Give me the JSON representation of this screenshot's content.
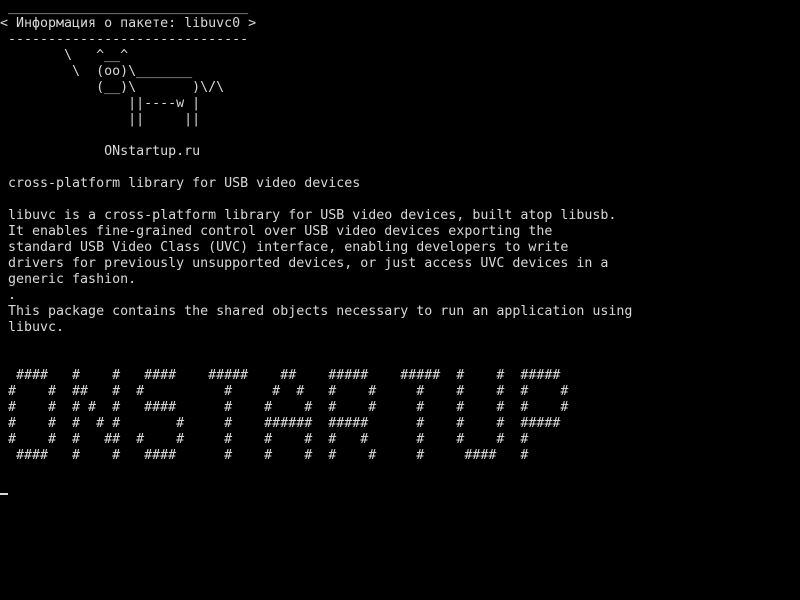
{
  "colors": {
    "background": "#000000",
    "foreground": "#d8d8d8"
  },
  "cowsay": {
    "border_top": " ______________________________",
    "message": "< Информация о пакете: libuvc0 >",
    "border_bottom": " ------------------------------",
    "cow_lines": [
      "        \\   ^__^",
      "         \\  (oo)\\_______",
      "            (__)\\       )\\/\\",
      "                ||----w |",
      "                ||     ||"
    ],
    "site": "             ONstartup.ru"
  },
  "package": {
    "summary": " cross-platform library for USB video devices",
    "description_lines": [
      " libuvc is a cross-platform library for USB video devices, built atop libusb.",
      " It enables fine-grained control over USB video devices exporting the",
      " standard USB Video Class (UVC) interface, enabling developers to write",
      " drivers for previously unsupported devices, or just access UVC devices in a",
      " generic fashion.",
      " .",
      " This package contains the shared objects necessary to run an application using",
      " libuvc."
    ]
  },
  "banner": {
    "lines": [
      "  ####   #    #   ####    #####    ##    #####    #####  #    #  #####",
      " #    #  ##   #  #          #     #  #   #    #     #    #    #  #    #",
      " #    #  # #  #   ####      #    #    #  #    #     #    #    #  #    #",
      " #    #  #  # #       #     #    ######  #####      #    #    #  #####",
      " #    #  #   ##  #    #     #    #    #  #   #      #    #    #  #",
      "  ####   #    #   ####      #    #    #  #    #     #     ####   #"
    ]
  }
}
